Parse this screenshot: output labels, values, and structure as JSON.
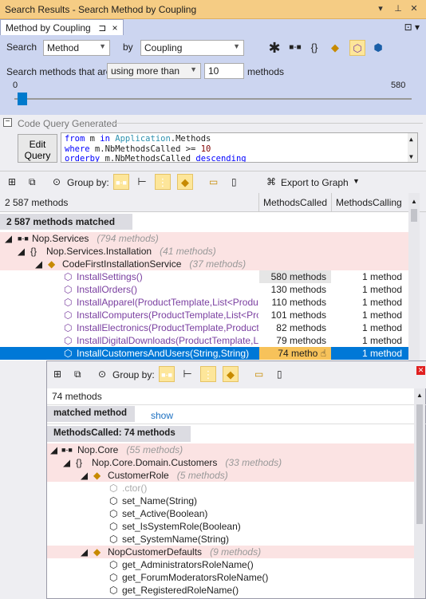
{
  "window": {
    "title": "Search Results - Search Method by Coupling",
    "tab_label": "Method by Coupling",
    "tab_pin": "⊐",
    "tab_close": "×"
  },
  "search": {
    "label": "Search",
    "type_value": "Method",
    "by_label": "by",
    "criteria_value": "Coupling",
    "methods_that_are_label": "Search methods that are",
    "operator_value": "using more than",
    "threshold_value": "10",
    "methods_label": "methods",
    "slider_min": "0",
    "slider_max": "580",
    "slider_value": 10
  },
  "code_query": {
    "header": "Code Query Generated",
    "edit_button": "Edit Query",
    "line1_kw": "from",
    "line1_rest": " m ",
    "line1_kw2": "in",
    "line1_ty": " Application",
    "line1_end": ".Methods",
    "line2_kw": "where",
    "line2_rest": " m.NbMethodsCalled >= ",
    "line2_num": "10",
    "line3_kw": "orderby",
    "line3_rest": " m.NbMethodsCalled ",
    "line3_kw2": "descending"
  },
  "results_toolbar": {
    "group_by_label": "Group by:",
    "export_label": "Export to Graph"
  },
  "columns": {
    "count": "2 587 methods",
    "methods_called": "MethodsCalled",
    "methods_calling": "MethodsCalling"
  },
  "matched_header": "2 587 methods matched",
  "tree": [
    {
      "name": "Nop.Services",
      "count": "(794 methods)"
    },
    {
      "name": "Nop.Services.Installation",
      "count": "(41 methods)"
    },
    {
      "name": "CodeFirstInstallationService",
      "count": "(37 methods)"
    },
    {
      "name": "InstallSettings()",
      "called": "580 methods",
      "calling": "1 method"
    },
    {
      "name": "InstallOrders()",
      "called": "130 methods",
      "calling": "1 method"
    },
    {
      "name": "InstallApparel(ProductTemplate,List<Product>",
      "called": "110 methods",
      "calling": "1 method"
    },
    {
      "name": "InstallComputers(ProductTemplate,List<Produ",
      "called": "101 methods",
      "calling": "1 method"
    },
    {
      "name": "InstallElectronics(ProductTemplate,ProductTe",
      "called": "82 methods",
      "calling": "1 method"
    },
    {
      "name": "InstallDigitalDownloads(ProductTemplate,List",
      "called": "79 methods",
      "calling": "1 method"
    },
    {
      "name": "InstallCustomersAndUsers(String,String)",
      "called": "74 metho",
      "calling": "1 method"
    }
  ],
  "popup": {
    "group_by_label": "Group by:",
    "count": "74 methods",
    "matched_tab": "matched method",
    "show_link": "show",
    "matched_header": "MethodsCalled: 74 methods",
    "tree": [
      {
        "name": "Nop.Core",
        "count": "(55 methods)"
      },
      {
        "name": "Nop.Core.Domain.Customers",
        "count": "(33 methods)"
      },
      {
        "name": "CustomerRole",
        "count": "(5 methods)"
      },
      {
        "name": ".ctor()"
      },
      {
        "name": "set_Name(String)"
      },
      {
        "name": "set_Active(Boolean)"
      },
      {
        "name": "set_IsSystemRole(Boolean)"
      },
      {
        "name": "set_SystemName(String)"
      },
      {
        "name": "NopCustomerDefaults",
        "count": "(9 methods)"
      },
      {
        "name": "get_AdministratorsRoleName()"
      },
      {
        "name": "get_ForumModeratorsRoleName()"
      },
      {
        "name": "get_RegisteredRoleName()"
      }
    ]
  }
}
